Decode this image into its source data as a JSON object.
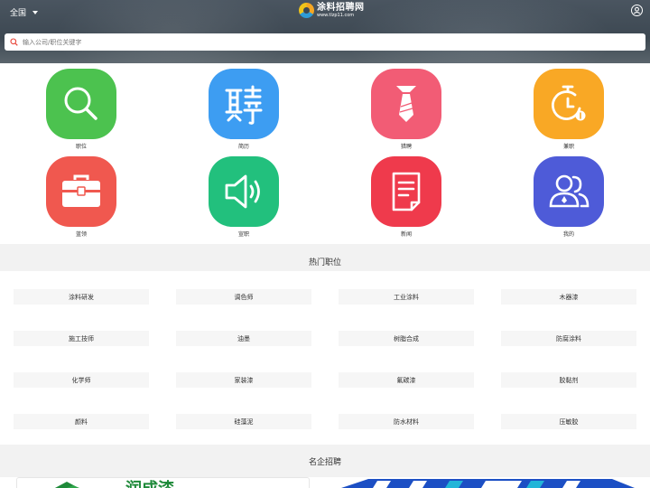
{
  "header": {
    "city": "全国",
    "logo_name": "涂料招聘网",
    "logo_url": "www.tlzp11.com"
  },
  "search": {
    "placeholder": "输入公司/职位关键字"
  },
  "menu": [
    {
      "label": "职位",
      "icon": "search-icon",
      "color": "#4cc24f"
    },
    {
      "label": "简历",
      "icon": "pin-char-icon",
      "color": "#3d9df2"
    },
    {
      "label": "猎聘",
      "icon": "necktie-icon",
      "color": "#f25c75"
    },
    {
      "label": "兼职",
      "icon": "timer-icon",
      "color": "#f9a825"
    },
    {
      "label": "蓝领",
      "icon": "toolbox-icon",
      "color": "#f0584f"
    },
    {
      "label": "宣职",
      "icon": "speaker-icon",
      "color": "#22c07d"
    },
    {
      "label": "新闻",
      "icon": "document-icon",
      "color": "#ef3a4c"
    },
    {
      "label": "我的",
      "icon": "users-icon",
      "color": "#4e5bd8"
    }
  ],
  "hot_jobs": {
    "title": "热门职位",
    "items": [
      "涂料研发",
      "调色师",
      "工业涂料",
      "木器漆",
      "施工技师",
      "油墨",
      "树脂合成",
      "防腐涂料",
      "化学师",
      "家装漆",
      "氟碳漆",
      "胶黏剂",
      "颜料",
      "硅藻泥",
      "防水材料",
      "压敏胶"
    ]
  },
  "famous": {
    "title": "名企招聘",
    "firm1_text": "润成漆"
  }
}
